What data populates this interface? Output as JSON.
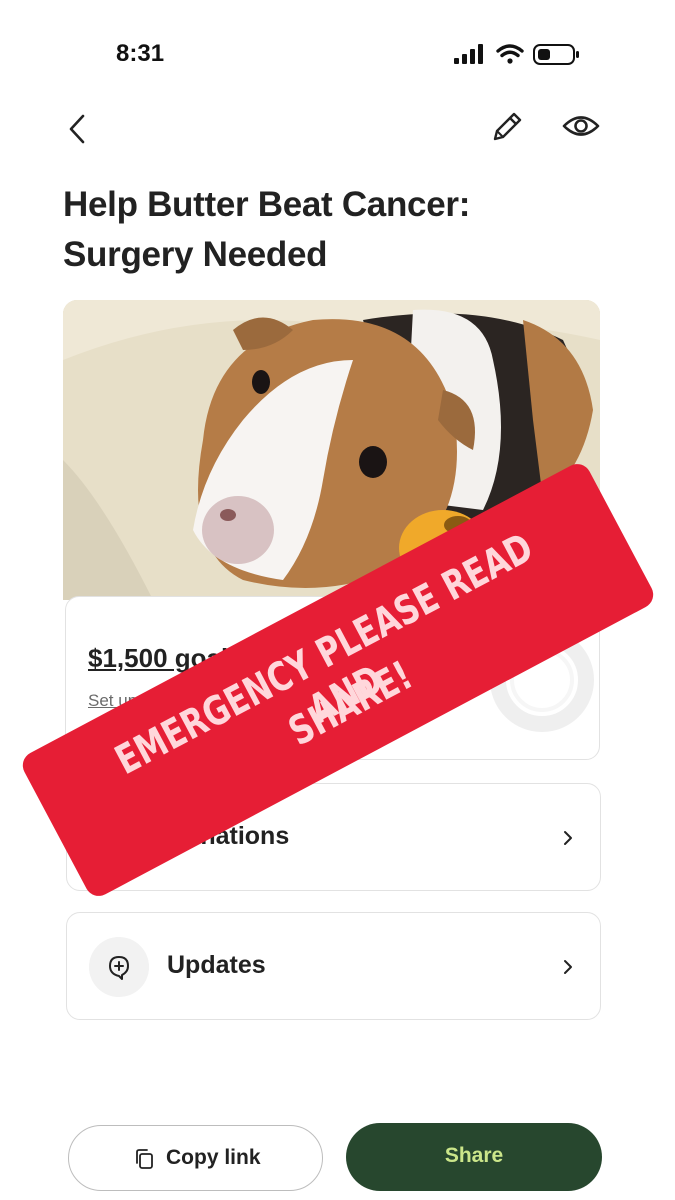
{
  "status_bar": {
    "time": "8:31"
  },
  "header": {
    "title": "Help Butter Beat Cancer: Surgery Needed"
  },
  "photo": {
    "subject": "guinea pig photo"
  },
  "goal": {
    "amount_text": "$1,500 goal",
    "link_text": "Set up trans"
  },
  "rows": [
    {
      "label": "Donations",
      "icon": "donations-icon"
    },
    {
      "label": "Updates",
      "icon": "add-update-icon"
    }
  ],
  "actions": {
    "copy_link_label": "Copy link",
    "share_label": "Share"
  },
  "sticker": {
    "line1": "EMERGENCY PLEASE READ AND",
    "line2": "SHARE!"
  },
  "colors": {
    "share_button": "#27472e",
    "share_text": "#cbe68a",
    "sticker": "#e61e35",
    "sticker_text": "#ffd7db"
  }
}
